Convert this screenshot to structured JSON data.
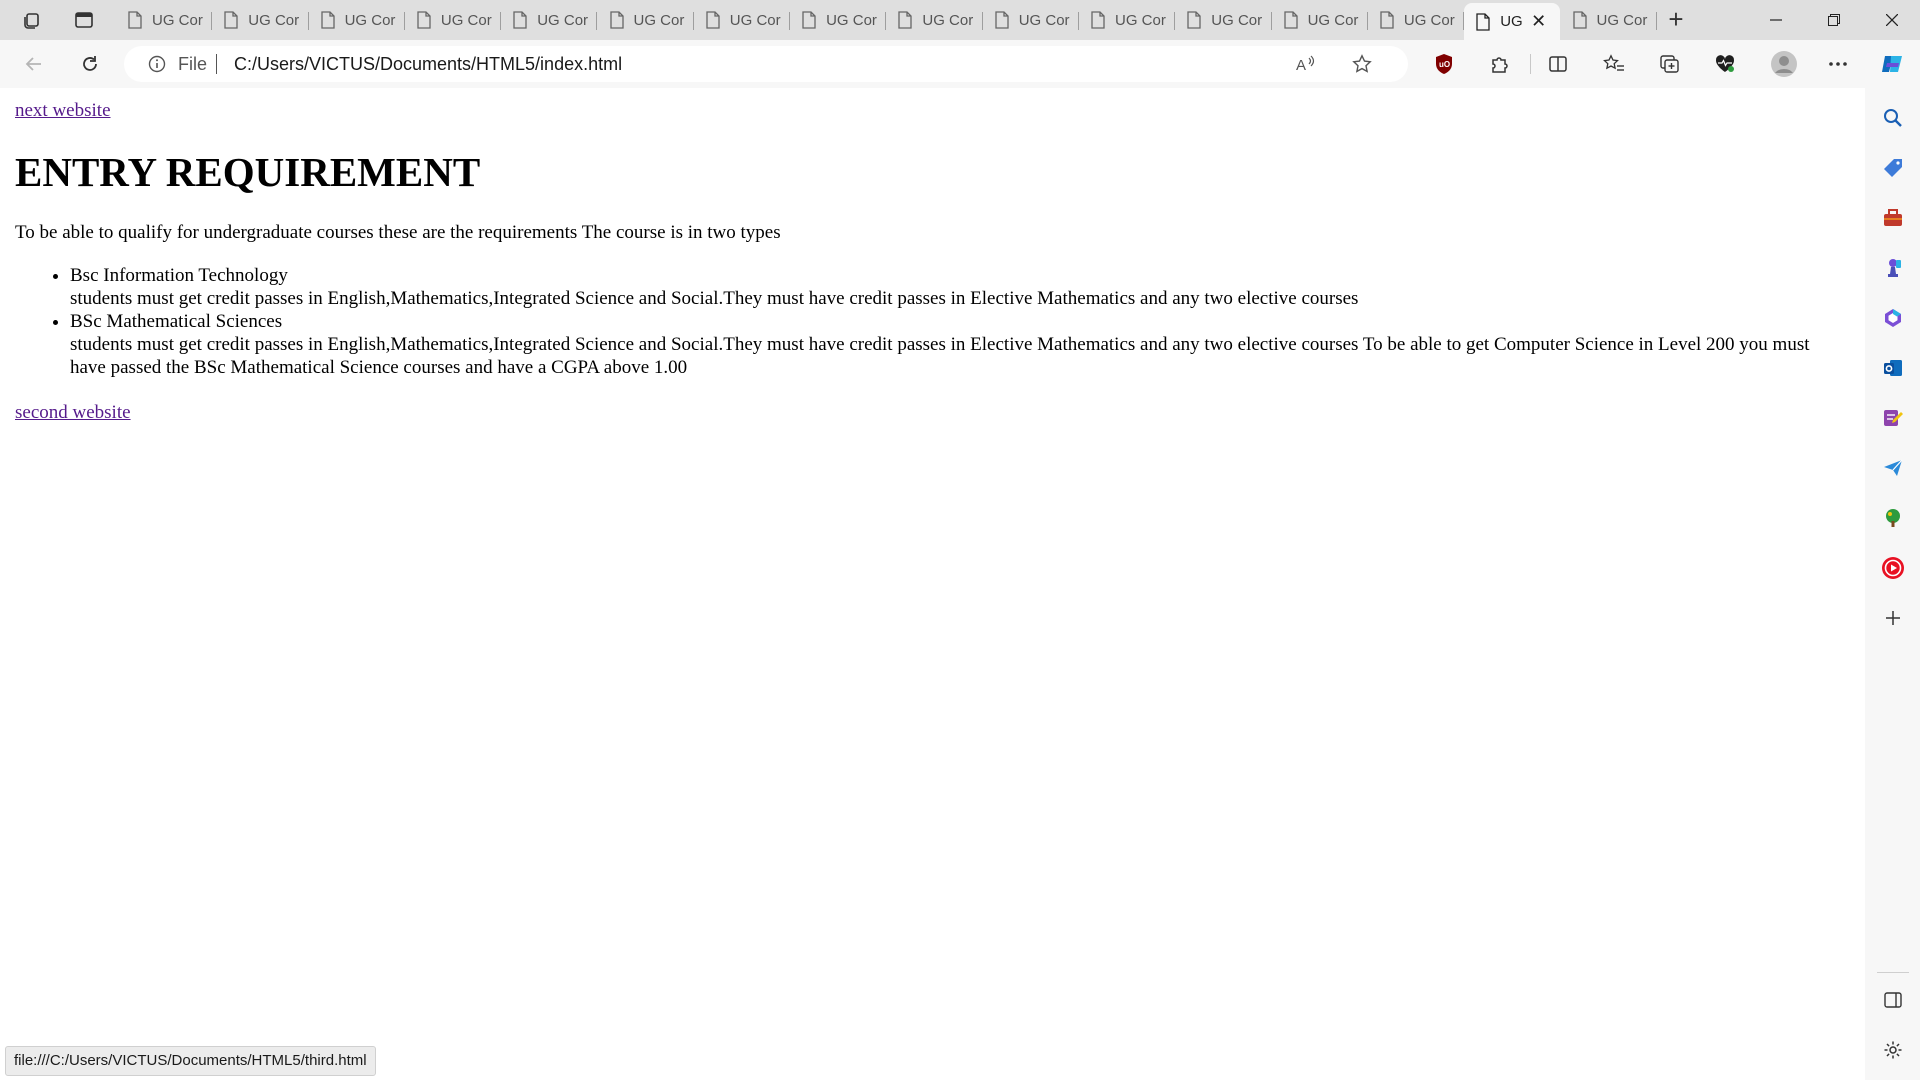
{
  "browser": {
    "tabs": [
      {
        "title": "UG Cor"
      },
      {
        "title": "UG Cor"
      },
      {
        "title": "UG Cor"
      },
      {
        "title": "UG Cor"
      },
      {
        "title": "UG Cor"
      },
      {
        "title": "UG Cor"
      },
      {
        "title": "UG Cor"
      },
      {
        "title": "UG Cor"
      },
      {
        "title": "UG Cor"
      },
      {
        "title": "UG Cor"
      },
      {
        "title": "UG Cor"
      },
      {
        "title": "UG Cor"
      },
      {
        "title": "UG Cor"
      },
      {
        "title": "UG Cor"
      },
      {
        "title": "UG"
      },
      {
        "title": "UG Cor"
      }
    ],
    "active_tab_index": 14,
    "address_bar": {
      "scheme_label": "File",
      "url": "C:/Users/VICTUS/Documents/HTML5/index.html"
    },
    "status_bar": "file:///C:/Users/VICTUS/Documents/HTML5/third.html",
    "accent_color": "#551a8b"
  },
  "page": {
    "top_link": "next website",
    "heading": "ENTRY REQUIREMENT",
    "intro": "To be able to qualify for undergraduate courses these are the requirements The course is in two types",
    "courses": [
      {
        "name": "Bsc Information Technology",
        "detail": "students must get credit passes in English,Mathematics,Integrated Science and Social.They must have credit passes in Elective Mathematics and any two elective courses"
      },
      {
        "name": "BSc Mathematical Sciences",
        "detail": "students must get credit passes in English,Mathematics,Integrated Science and Social.They must have credit passes in Elective Mathematics and any two elective courses To be able to get Computer Science in Level 200 you must have passed the BSc Mathematical Science courses and have a CGPA above 1.00"
      }
    ],
    "bottom_link": "second website"
  }
}
